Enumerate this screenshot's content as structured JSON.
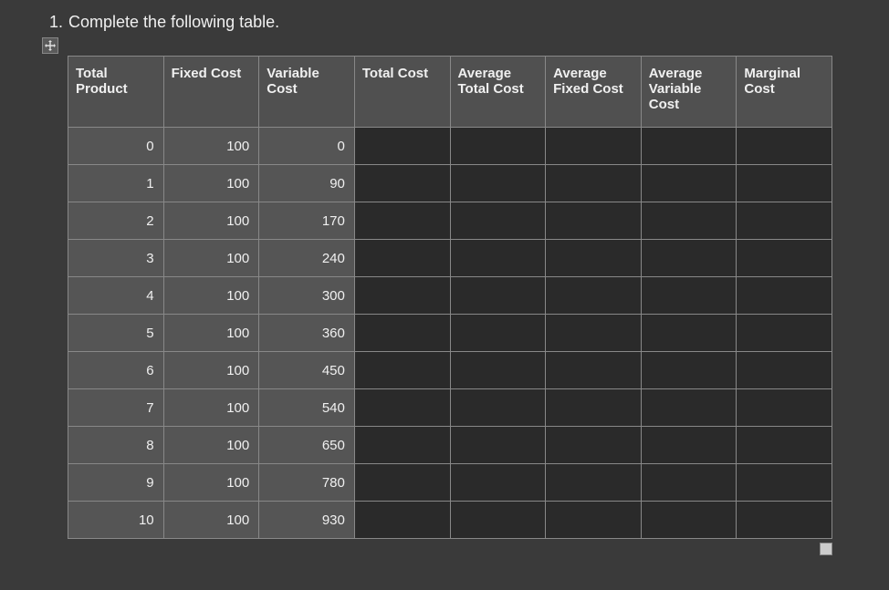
{
  "question": {
    "number": "1.",
    "text": "Complete the following table."
  },
  "icons": {
    "move": "move-icon"
  },
  "table": {
    "headers": [
      "Total Product",
      "Fixed Cost",
      "Variable Cost",
      "Total Cost",
      "Average Total Cost",
      "Average Fixed Cost",
      "Average Variable Cost",
      "Marginal Cost"
    ],
    "rows": [
      {
        "total_product": "0",
        "fixed_cost": "100",
        "variable_cost": "0"
      },
      {
        "total_product": "1",
        "fixed_cost": "100",
        "variable_cost": "90"
      },
      {
        "total_product": "2",
        "fixed_cost": "100",
        "variable_cost": "170"
      },
      {
        "total_product": "3",
        "fixed_cost": "100",
        "variable_cost": "240"
      },
      {
        "total_product": "4",
        "fixed_cost": "100",
        "variable_cost": "300"
      },
      {
        "total_product": "5",
        "fixed_cost": "100",
        "variable_cost": "360"
      },
      {
        "total_product": "6",
        "fixed_cost": "100",
        "variable_cost": "450"
      },
      {
        "total_product": "7",
        "fixed_cost": "100",
        "variable_cost": "540"
      },
      {
        "total_product": "8",
        "fixed_cost": "100",
        "variable_cost": "650"
      },
      {
        "total_product": "9",
        "fixed_cost": "100",
        "variable_cost": "780"
      },
      {
        "total_product": "10",
        "fixed_cost": "100",
        "variable_cost": "930"
      }
    ]
  }
}
